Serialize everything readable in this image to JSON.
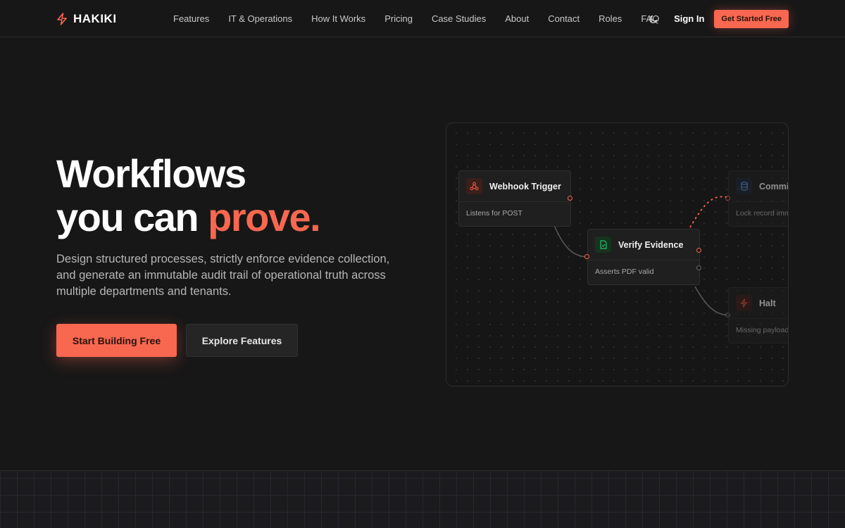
{
  "brand": {
    "name": "HAKIKI",
    "icon": "lightning-icon",
    "accent_color": "#f8674f"
  },
  "nav": {
    "links": [
      "Features",
      "IT & Operations",
      "How It Works",
      "Pricing",
      "Case Studies",
      "About",
      "Contact",
      "Roles",
      "FAQ"
    ],
    "theme_toggle_icon": "moon-icon",
    "sign_in": "Sign In",
    "cta": "Get Started Free"
  },
  "hero": {
    "title_line1": "Workflows",
    "title_line2_prefix": "you can ",
    "title_line2_accent": "prove.",
    "subtitle": "Design structured processes, strictly enforce evidence collection, and generate an immutable audit trail of operational truth across multiple departments and tenants.",
    "primary_button": "Start Building Free",
    "secondary_button": "Explore Features"
  },
  "workflow": {
    "nodes": [
      {
        "title": "Webhook Trigger",
        "description": "Listens for POST",
        "icon": "webhook-icon",
        "color": "#e5533f"
      },
      {
        "title": "Verify Evidence",
        "description": "Asserts PDF valid",
        "icon": "file-check-icon",
        "color": "#2fbf71"
      },
      {
        "title": "Commit",
        "description": "Lock record imm",
        "icon": "database-icon",
        "color": "#5a8fd8"
      },
      {
        "title": "Halt",
        "description": "Missing payload",
        "icon": "lightning-icon",
        "color": "#e5533f"
      }
    ]
  }
}
